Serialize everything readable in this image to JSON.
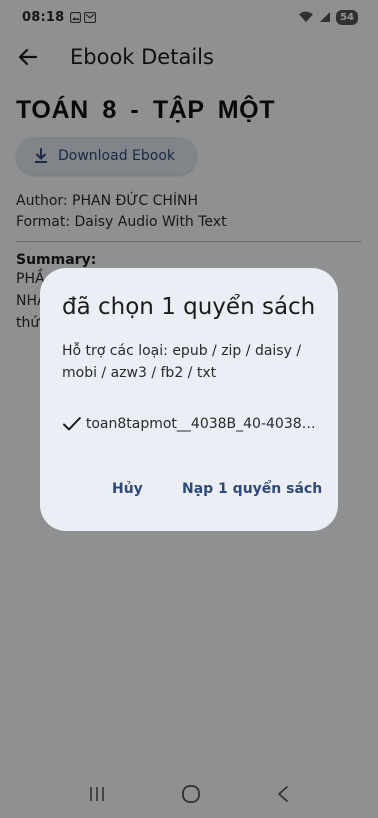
{
  "status_bar": {
    "time": "08:18",
    "battery": "54"
  },
  "app_bar": {
    "title": "Ebook Details"
  },
  "book": {
    "title": "TOÁN 8 - TẬP MỘT",
    "download_label": "Download Ebook",
    "author_line": "Author: PHAN ĐỨC CHÍNH",
    "format_line": "Format: Daisy Audio With Text",
    "summary_label": "Summary:",
    "summary_lines": [
      "PHẦ",
      "NHÀ",
      "thứ"
    ]
  },
  "dialog": {
    "title": "đã chọn 1 quyển sách",
    "subtitle": "Hỗ trợ các loại: epub / zip / daisy / mobi / azw3 / fb2 / txt",
    "file_name": "toan8tapmot__4038B_40-4038B...",
    "cancel_label": "Hủy",
    "confirm_label": "Nạp 1 quyển sách"
  },
  "colors": {
    "accent": "#2f4a78",
    "dialog_bg": "#eceef5",
    "scrim": "#000000"
  }
}
